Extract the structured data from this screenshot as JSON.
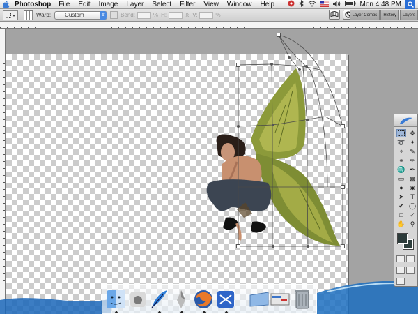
{
  "menubar": {
    "apple_icon": "apple-icon",
    "app_name": "Photoshop",
    "items": [
      "File",
      "Edit",
      "Image",
      "Layer",
      "Select",
      "Filter",
      "View",
      "Window",
      "Help"
    ],
    "clock": "Mon 4:48 PM",
    "status_icons": [
      "adobe-updater-icon",
      "bluetooth-icon",
      "airport-icon",
      "flag-icon",
      "volume-icon",
      "battery-icon",
      "spotlight-icon"
    ]
  },
  "options": {
    "warp_label": "Warp:",
    "warp_value": "Custom",
    "bend_label": "Bend:",
    "h_label": "H:",
    "v_label": "V:",
    "percent": "%",
    "palette_tabs": [
      "Layer Comps",
      "History",
      "Layers"
    ]
  },
  "dock": {
    "icons": [
      "finder-icon",
      "apple-store-icon",
      "feather-icon",
      "photoshop-icon",
      "firefox-icon",
      "mail-icon",
      "folder-icon",
      "terminal-icon",
      "trash-icon"
    ]
  },
  "colors": {
    "foreground": "#2c3b3a",
    "background": "#2e3f3d",
    "selection_accent": "#4a8ae2"
  }
}
